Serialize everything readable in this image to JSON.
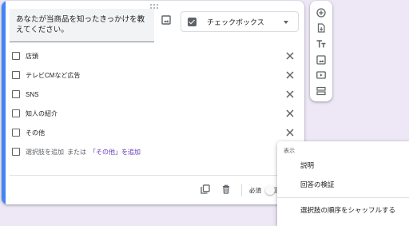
{
  "question": {
    "title": "あなたが当商品を知ったきっかけを教えてください。"
  },
  "type_select": {
    "label": "チェックボックス",
    "icon": "checkbox-icon"
  },
  "options": [
    {
      "label": "店頭"
    },
    {
      "label": "テレビCMなど広告"
    },
    {
      "label": "SNS"
    },
    {
      "label": "知人の紹介"
    },
    {
      "label": "その他"
    }
  ],
  "add_option": {
    "prefix": "選択肢を追加",
    "or": "または",
    "other_link": "「その他」を追加"
  },
  "footer": {
    "required_label": "必須",
    "required_on": false
  },
  "side_toolbar": [
    "add-question-icon",
    "import-questions-icon",
    "add-title-icon",
    "add-image-icon",
    "add-video-icon",
    "add-section-icon"
  ],
  "menu": {
    "header": "表示",
    "items": [
      {
        "label": "説明"
      },
      {
        "label": "回答の検証"
      },
      {
        "label": "選択肢の順序をシャッフルする"
      }
    ]
  },
  "colors": {
    "background": "#ede7f6",
    "accent_left_bar": "#4285f4",
    "link": "#673ab7"
  }
}
